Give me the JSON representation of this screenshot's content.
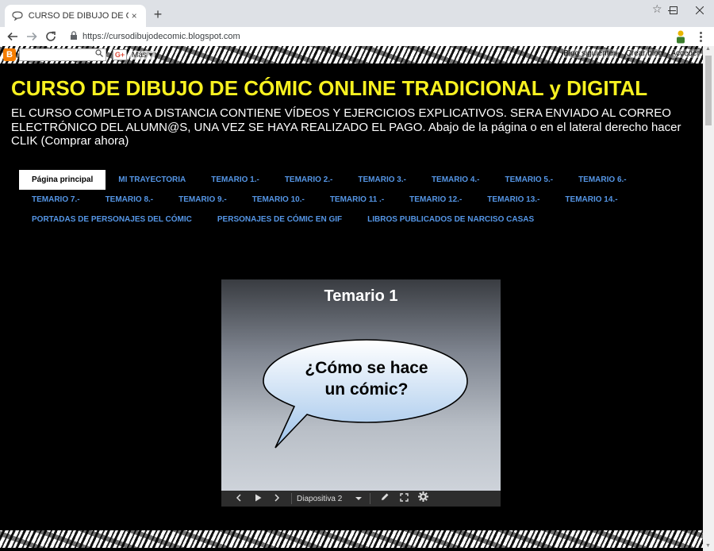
{
  "browser": {
    "tab_title": "CURSO DE DIBUJO DE CÓMIC O",
    "tab_close": "×",
    "new_tab": "+",
    "url": "https://cursodibujodecomic.blogspot.com",
    "star": "☆"
  },
  "blogger_bar": {
    "logo": "B",
    "gplus": "G+",
    "more": "Más ▾",
    "links": [
      "Blog siguiente»",
      "Crear blog",
      "Acceder"
    ]
  },
  "blog": {
    "title": "CURSO DE DIBUJO DE CÓMIC ONLINE TRADICIONAL y DIGITAL",
    "description": "EL CURSO COMPLETO A DISTANCIA CONTIENE VÍDEOS Y EJERCICIOS EXPLICATIVOS. SERA ENVIADO AL CORREO ELECTRÓNICO DEL ALUMN@S, UNA VEZ SE HAYA REALIZADO EL PAGO. Abajo de la página o en el lateral derecho hacer CLIK (Comprar ahora)"
  },
  "pages": {
    "row1": [
      "Página principal",
      "MI TRAYECTORIA",
      "TEMARIO 1.-",
      "TEMARIO 2.-",
      "TEMARIO 3.-",
      "TEMARIO 4.-",
      "TEMARIO 5.-",
      "TEMARIO 6.-"
    ],
    "row2": [
      "TEMARIO 7.-",
      "TEMARIO 8.-",
      "TEMARIO 9.-",
      "TEMARIO 10.-",
      "TEMARIO 11 .-",
      "TEMARIO 12.-",
      "TEMARIO 13.-",
      "TEMARIO 14.-"
    ],
    "row3": [
      "PORTADAS DE PERSONAJES DEL CÓMIC",
      "PERSONAJES DE CÓMIC EN GIF",
      "LIBROS PUBLICADOS DE NARCISO CASAS"
    ]
  },
  "slideshow": {
    "title": "Temario 1",
    "bubble_line1": "¿Cómo se hace",
    "bubble_line2": "un cómic?",
    "slide_label": "Diapositiva 2"
  },
  "colors": {
    "title_yellow": "#f8f120",
    "tab_link_blue": "#5596e6",
    "page_bg": "#000000"
  }
}
